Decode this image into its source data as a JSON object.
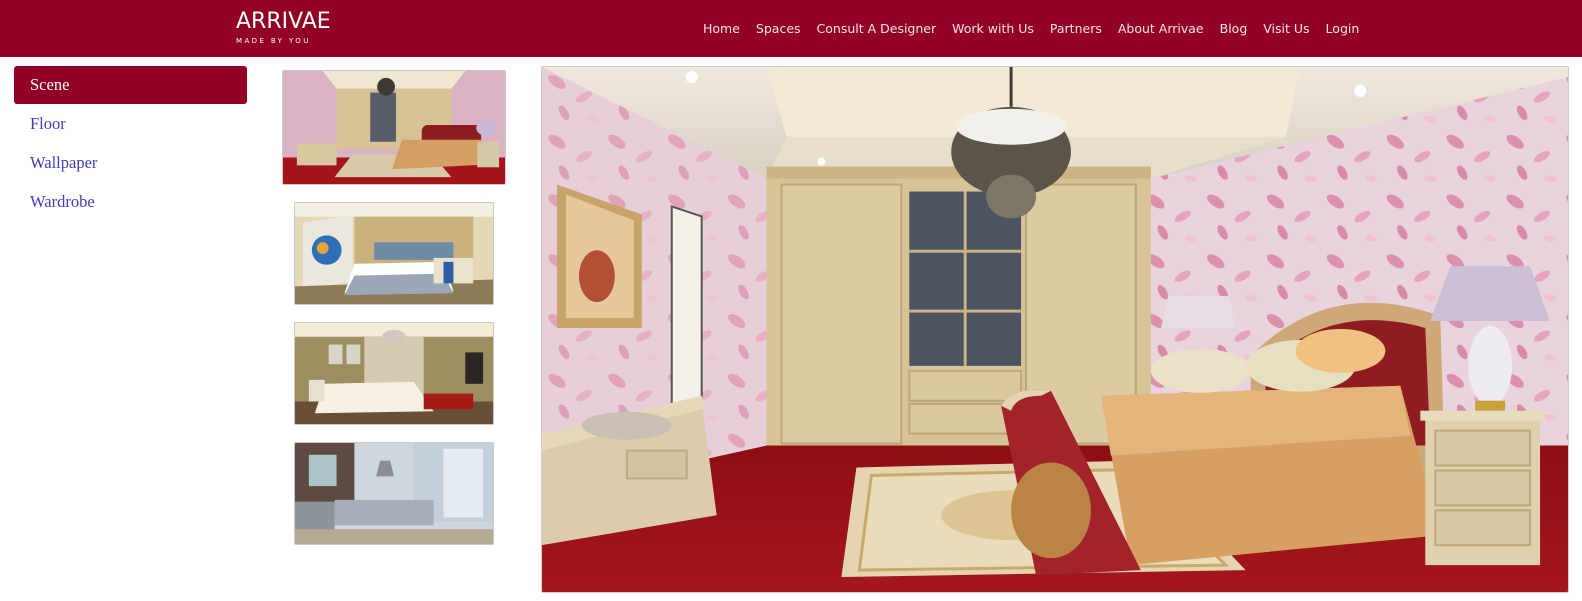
{
  "header": {
    "logo_text": "ARRIVAE",
    "logo_tagline": "MADE BY YOU",
    "nav": [
      "Home",
      "Spaces",
      "Consult A Designer",
      "Work with Us",
      "Partners",
      "About Arrivae",
      "Blog",
      "Visit Us",
      "Login"
    ],
    "brand_color": "#920027"
  },
  "sidebar": {
    "items": [
      {
        "label": "Scene",
        "active": true
      },
      {
        "label": "Floor",
        "active": false
      },
      {
        "label": "Wallpaper",
        "active": false
      },
      {
        "label": "Wardrobe",
        "active": false
      }
    ],
    "link_color": "#3f3fb3"
  },
  "thumbnails": [
    {
      "scene": "bedroom-pink-wallpaper",
      "selected": true
    },
    {
      "scene": "bedroom-mural",
      "selected": false
    },
    {
      "scene": "bedroom-olive",
      "selected": false
    },
    {
      "scene": "kitchen",
      "selected": false
    }
  ],
  "main_view": {
    "scene": "bedroom-pink-wallpaper"
  }
}
